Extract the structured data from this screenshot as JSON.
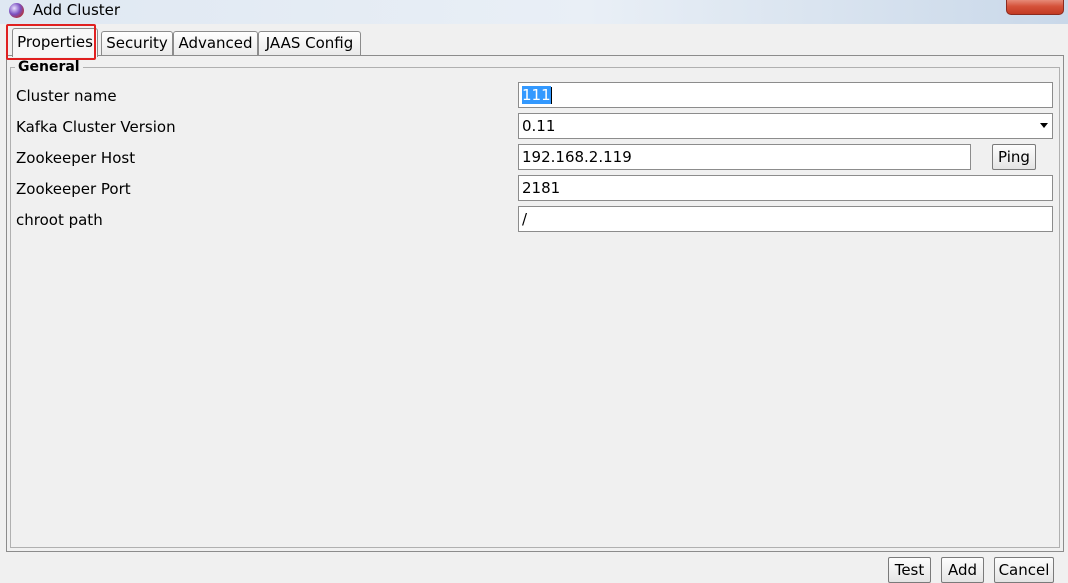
{
  "window": {
    "title": "Add Cluster",
    "icon": "app-icon",
    "close_color": "#c9442c"
  },
  "tabs": [
    {
      "label": "Properties",
      "active": true
    },
    {
      "label": "Security",
      "active": false
    },
    {
      "label": "Advanced",
      "active": false
    },
    {
      "label": "JAAS Config",
      "active": false
    }
  ],
  "annotation": {
    "highlight_color": "#e02020",
    "highlighted_tab": "Properties"
  },
  "general": {
    "group_title": "General",
    "cluster_name": {
      "label": "Cluster name",
      "value": "111"
    },
    "kafka_version": {
      "label": "Kafka Cluster Version",
      "value": "0.11"
    },
    "zookeeper_host": {
      "label": "Zookeeper Host",
      "value": "192.168.2.119",
      "ping_label": "Ping"
    },
    "zookeeper_port": {
      "label": "Zookeeper Port",
      "value": "2181"
    },
    "chroot_path": {
      "label": "chroot path",
      "value": "/"
    }
  },
  "buttons": {
    "test": "Test",
    "add": "Add",
    "cancel": "Cancel"
  },
  "colors": {
    "selection": "#3399ff",
    "background": "#f0f0f0"
  }
}
